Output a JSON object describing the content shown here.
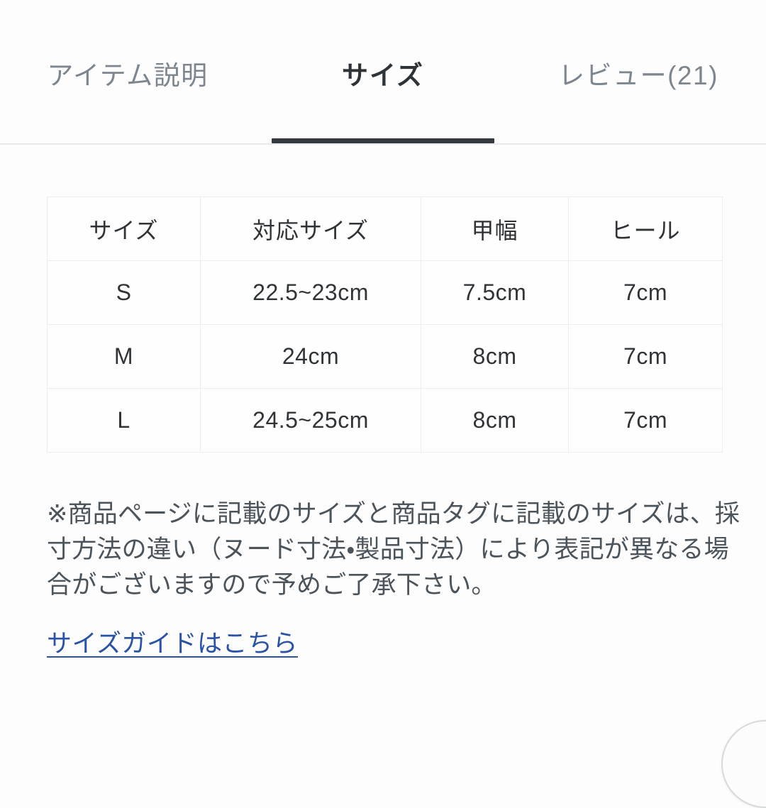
{
  "tabs": {
    "items": [
      {
        "label": "アイテム説明",
        "active": false,
        "name": "tab-item-description"
      },
      {
        "label": "サイズ",
        "active": true,
        "name": "tab-size"
      },
      {
        "label": "レビュー(21)",
        "active": false,
        "name": "tab-reviews"
      }
    ],
    "active_index": 1,
    "active_underline_color": "#343a40",
    "inactive_color": "#7d868f",
    "active_color": "#2e3338"
  },
  "size_table": {
    "headers": [
      "サイズ",
      "対応サイズ",
      "甲幅",
      "ヒール"
    ],
    "rows": [
      [
        "S",
        "22.5~23cm",
        "7.5cm",
        "7cm"
      ],
      [
        "M",
        "24cm",
        "8cm",
        "7cm"
      ],
      [
        "L",
        "24.5~25cm",
        "8cm",
        "7cm"
      ]
    ],
    "border_color": "#eceded"
  },
  "note": {
    "line1": "※商品ページに記載のサイズと商品タグに記載のサイズは、採",
    "line2": "寸方法の違い（ヌード寸法・製品寸法）により表記が異なる場",
    "line3": "合がございますので予めご了承下さい。",
    "color": "#4b535b"
  },
  "guide_link": {
    "label": "サイズガイドはこちら",
    "color": "#2a52a5"
  },
  "floating_button": {
    "name": "scroll-to-top-button"
  },
  "page": {
    "background": "#fdfdfd",
    "divider_color": "#e7e8ea"
  }
}
